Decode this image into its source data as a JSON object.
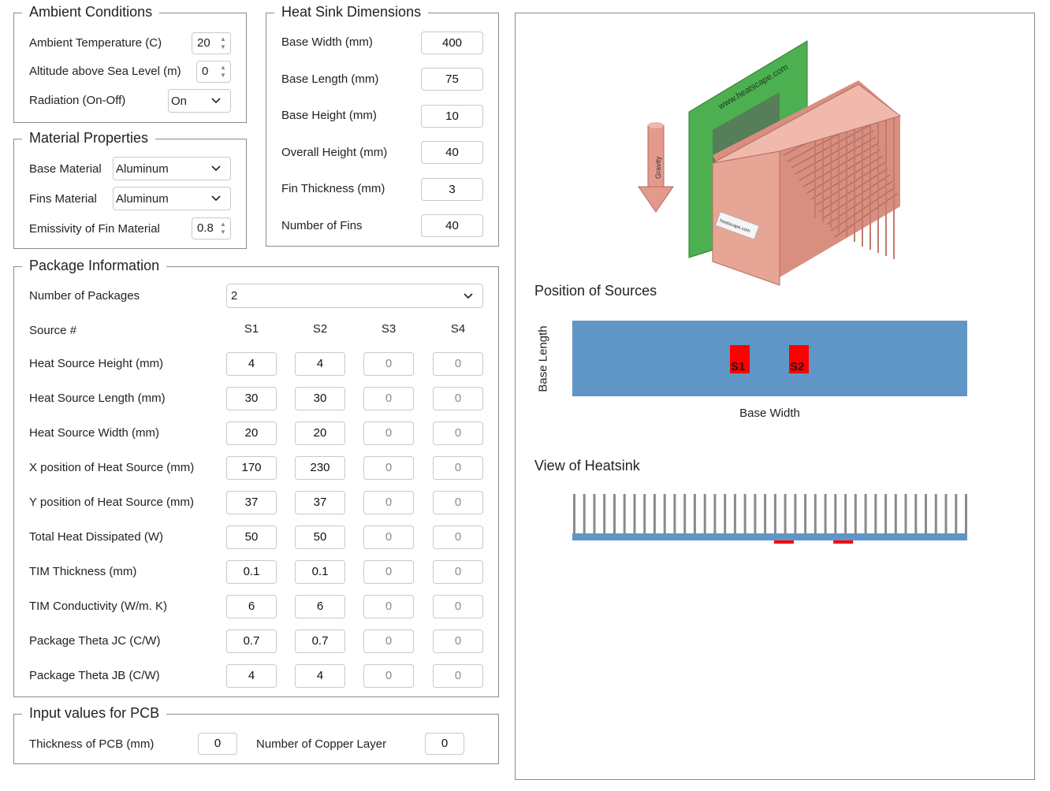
{
  "ambient": {
    "title": "Ambient Conditions",
    "temp_label": "Ambient Temperature (C)",
    "temp_value": "20",
    "altitude_label": "Altitude above Sea Level (m)",
    "altitude_value": "0",
    "radiation_label": "Radiation (On-Off)",
    "radiation_value": "On"
  },
  "material": {
    "title": "Material Properties",
    "base_label": "Base Material",
    "base_value": "Aluminum",
    "fins_label": "Fins Material",
    "fins_value": "Aluminum",
    "emissivity_label": "Emissivity of Fin Material",
    "emissivity_value": "0.8"
  },
  "heatsink": {
    "title": "Heat Sink Dimensions",
    "rows": [
      {
        "label": "Base Width (mm)",
        "value": "400"
      },
      {
        "label": "Base Length (mm)",
        "value": "75"
      },
      {
        "label": "Base Height (mm)",
        "value": "10"
      },
      {
        "label": "Overall Height (mm)",
        "value": "40"
      },
      {
        "label": "Fin Thickness (mm)",
        "value": "3"
      },
      {
        "label": "Number of Fins",
        "value": "40"
      }
    ]
  },
  "package": {
    "title": "Package Information",
    "num_label": "Number of Packages",
    "num_value": "2",
    "source_label": "Source #",
    "columns": [
      "S1",
      "S2",
      "S3",
      "S4"
    ],
    "rows": [
      {
        "label": "Heat Source Height (mm)",
        "values": [
          "4",
          "4",
          "0",
          "0"
        ]
      },
      {
        "label": "Heat Source Length (mm)",
        "values": [
          "30",
          "30",
          "0",
          "0"
        ]
      },
      {
        "label": "Heat Source Width (mm)",
        "values": [
          "20",
          "20",
          "0",
          "0"
        ]
      },
      {
        "label": "X position of Heat Source (mm)",
        "values": [
          "170",
          "230",
          "0",
          "0"
        ]
      },
      {
        "label": "Y position of Heat Source (mm)",
        "values": [
          "37",
          "37",
          "0",
          "0"
        ]
      },
      {
        "label": "Total Heat Dissipated (W)",
        "values": [
          "50",
          "50",
          "0",
          "0"
        ]
      },
      {
        "label": "TIM Thickness (mm)",
        "values": [
          "0.1",
          "0.1",
          "0",
          "0"
        ]
      },
      {
        "label": "TIM Conductivity (W/m. K)",
        "values": [
          "6",
          "6",
          "0",
          "0"
        ]
      },
      {
        "label": "Package Theta JC (C/W)",
        "values": [
          "0.7",
          "0.7",
          "0",
          "0"
        ]
      },
      {
        "label": "Package Theta JB (C/W)",
        "values": [
          "4",
          "4",
          "0",
          "0"
        ]
      }
    ]
  },
  "pcb": {
    "title": "Input values for PCB",
    "thickness_label": "Thickness of PCB (mm)",
    "thickness_value": "0",
    "copper_label": "Number of Copper Layer",
    "copper_value": "0"
  },
  "preview": {
    "website_text": "www.heatscape.com",
    "logo_text": "heatscape.com",
    "gravity_label": "Gravity",
    "positions_title": "Position of Sources",
    "axis_y": "Base Length",
    "axis_x": "Base Width",
    "source_labels": [
      "S1",
      "S2"
    ],
    "view_title": "View of Heatsink"
  },
  "colors": {
    "plate": "#6096c6",
    "source": "#ff0000",
    "fin": "#8a8a8a",
    "pcb_green": "#4caf50",
    "copper": "#e6a393"
  }
}
